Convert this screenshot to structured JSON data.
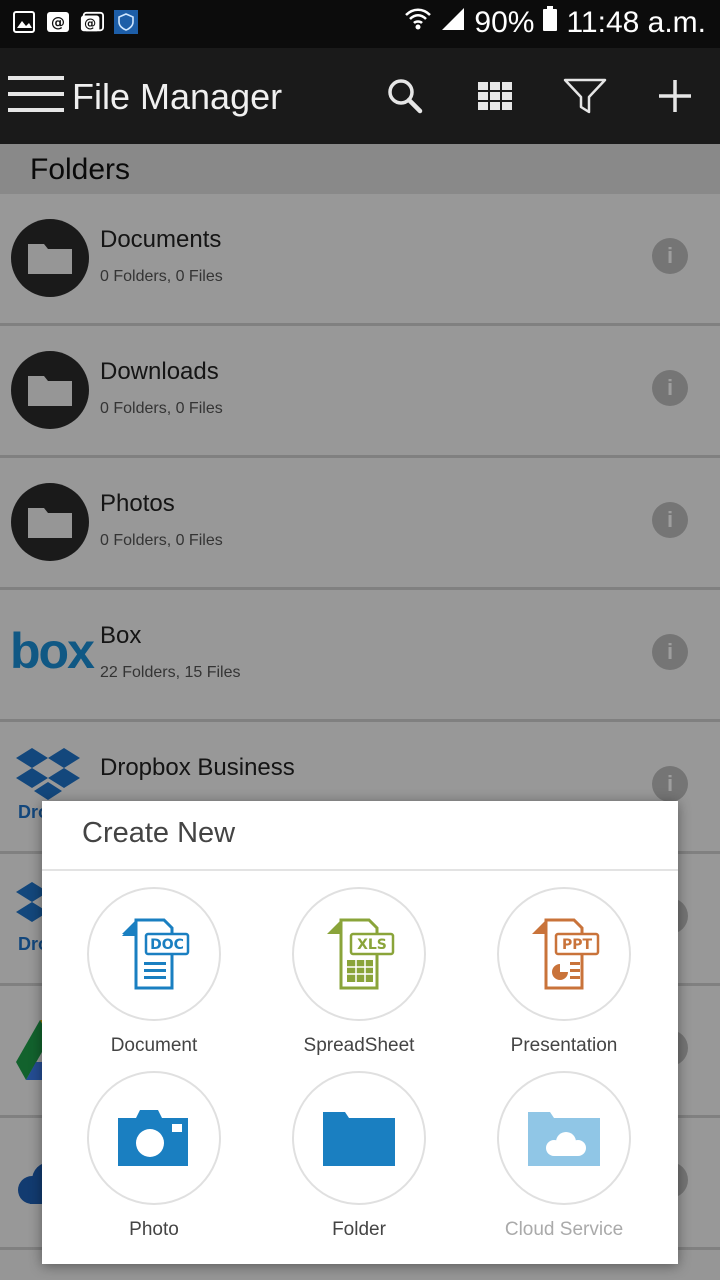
{
  "status_bar": {
    "battery": "90%",
    "time": "11:48 a.m.",
    "icons": [
      "gallery-icon",
      "mail-at-icon",
      "mail-at-icon-2",
      "shield-app-icon",
      "wifi-icon",
      "signal-icon",
      "battery-icon"
    ]
  },
  "app_bar": {
    "title": "File Manager",
    "icons": [
      "menu-icon",
      "search-icon",
      "grid-view-icon",
      "filter-icon",
      "add-icon"
    ]
  },
  "section": {
    "title": "Folders"
  },
  "folders": [
    {
      "name": "Documents",
      "meta": "0 Folders, 0 Files",
      "icon": "folder-icon"
    },
    {
      "name": "Downloads",
      "meta": "0 Folders, 0 Files",
      "icon": "folder-icon"
    },
    {
      "name": "Photos",
      "meta": "0 Folders, 0 Files",
      "icon": "folder-icon"
    },
    {
      "name": "Box",
      "meta": "22 Folders, 15 Files",
      "icon": "box-logo",
      "logo_text": "box"
    },
    {
      "name": "Dropbox Business",
      "meta": "",
      "icon": "dropbox-logo",
      "logo_text": "Dro"
    }
  ],
  "dialog": {
    "title": "Create New",
    "options": [
      {
        "label": "Document",
        "icon": "doc-file-icon",
        "badge": "DOC",
        "color": "#1a7fc1",
        "enabled": true
      },
      {
        "label": "SpreadSheet",
        "icon": "xls-file-icon",
        "badge": "XLS",
        "color": "#8aa43a",
        "enabled": true
      },
      {
        "label": "Presentation",
        "icon": "ppt-file-icon",
        "badge": "PPT",
        "color": "#c9733a",
        "enabled": true
      },
      {
        "label": "Photo",
        "icon": "camera-icon",
        "color": "#1a7fc1",
        "enabled": true
      },
      {
        "label": "Folder",
        "icon": "folder-icon",
        "color": "#1a7fc1",
        "enabled": true
      },
      {
        "label": "Cloud Service",
        "icon": "cloud-folder-icon",
        "color": "#90c6e6",
        "enabled": false
      }
    ]
  },
  "colors": {
    "status_bar_bg": "#0c0c0c",
    "app_bar_bg": "#1a1a1a",
    "box_blue": "#1a8fd6",
    "dropbox_blue": "#1f73c9"
  }
}
